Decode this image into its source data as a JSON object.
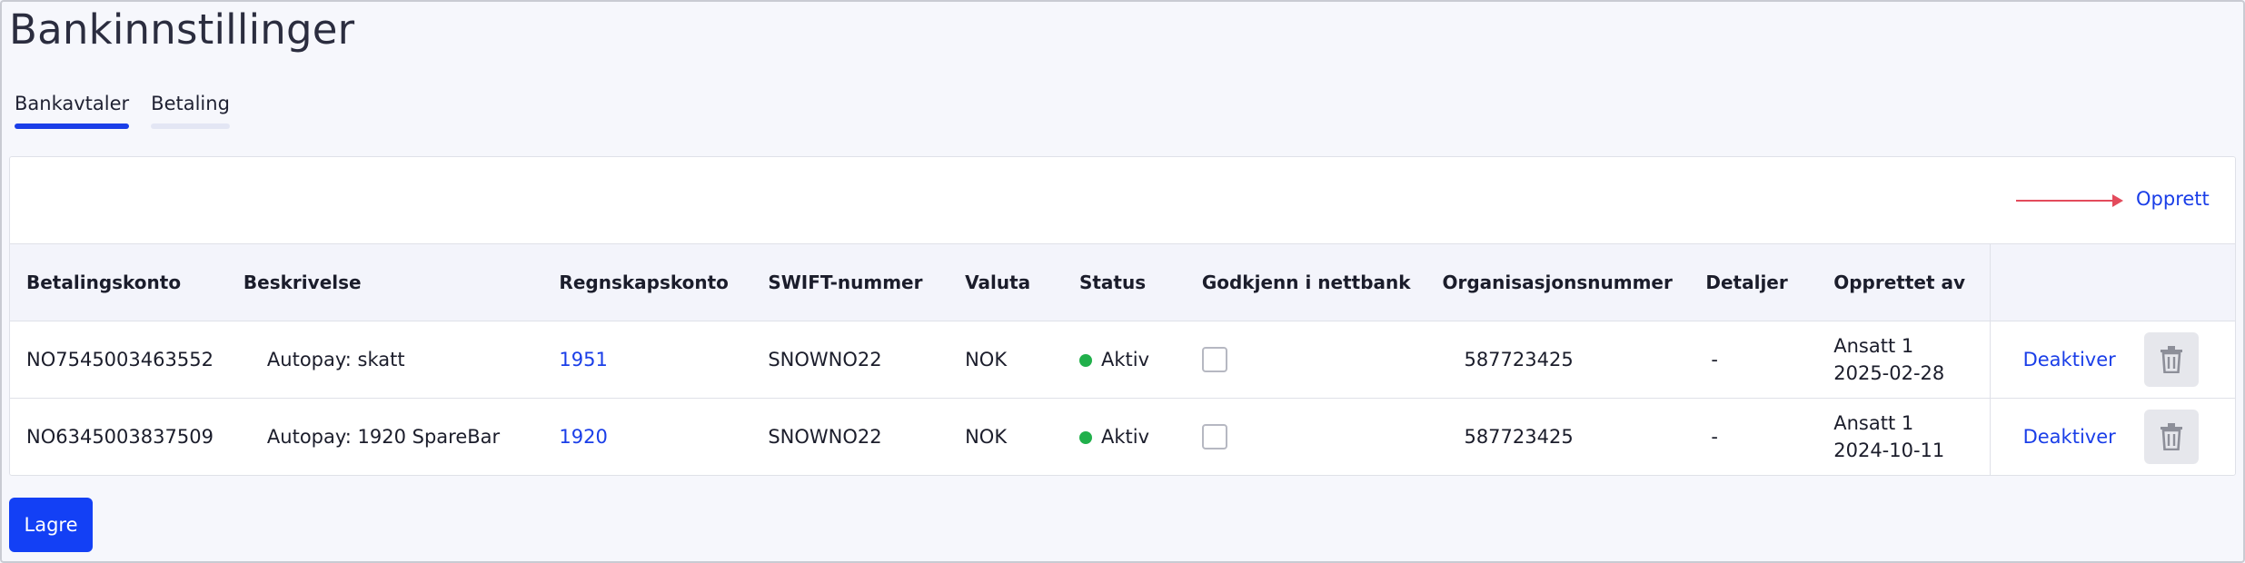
{
  "page": {
    "title": "Bankinnstillinger"
  },
  "tabs": [
    {
      "label": "Bankavtaler",
      "active": true
    },
    {
      "label": "Betaling",
      "active": false
    }
  ],
  "toolbar": {
    "create_label": "Opprett"
  },
  "table": {
    "headers": [
      "Betalingskonto",
      "Beskrivelse",
      "Regnskapskonto",
      "SWIFT-nummer",
      "Valuta",
      "Status",
      "Godkjenn i nettbank",
      "Organisasjonsnummer",
      "Detaljer",
      "Opprettet av"
    ],
    "rows": [
      {
        "account": "NO7545003463552",
        "description": "Autopay: skatt",
        "ledger": "1951",
        "swift": "SNOWNO22",
        "currency": "NOK",
        "status": "Aktiv",
        "approve_in_netbank": false,
        "org_number": "587723425",
        "details": "-",
        "created_by": "Ansatt 1",
        "created_date": "2025-02-28",
        "action": "Deaktiver"
      },
      {
        "account": "NO6345003837509",
        "description": "Autopay: 1920 SpareBar",
        "ledger": "1920",
        "swift": "SNOWNO22",
        "currency": "NOK",
        "status": "Aktiv",
        "approve_in_netbank": false,
        "org_number": "587723425",
        "details": "-",
        "created_by": "Ansatt 1",
        "created_date": "2024-10-11",
        "action": "Deaktiver"
      }
    ]
  },
  "footer": {
    "save_label": "Lagre"
  },
  "colors": {
    "accent": "#1a3ee8",
    "status_active": "#21b04b",
    "arrow": "#e34b5c"
  },
  "icons": {
    "delete": "trash-icon"
  }
}
